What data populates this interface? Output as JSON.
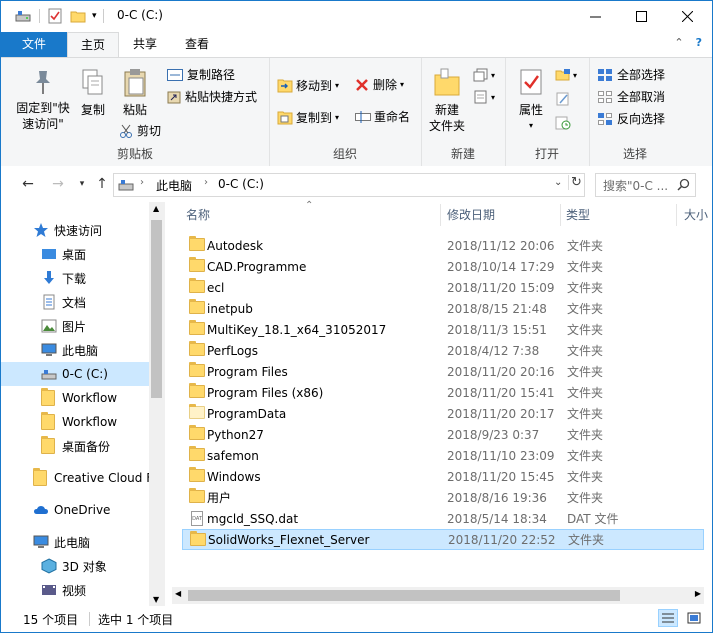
{
  "window": {
    "title": "0-C (C:)"
  },
  "tabs": [
    {
      "label": "文件"
    },
    {
      "label": "主页"
    },
    {
      "label": "共享"
    },
    {
      "label": "查看"
    }
  ],
  "ribbon": {
    "clipboard": {
      "pin_label": "固定到\"快\n速访问\"",
      "pin_label_line1": "固定到\"快",
      "pin_label_line2": "速访问\"",
      "copy_label": "复制",
      "paste_label": "粘贴",
      "copy_path_label": "复制路径",
      "paste_shortcut_label": "粘贴快捷方式",
      "cut_label": "剪切",
      "group_label": "剪贴板"
    },
    "organize": {
      "move_to_label": "移动到",
      "copy_to_label": "复制到",
      "delete_label": "删除",
      "rename_label": "重命名",
      "group_label": "组织"
    },
    "new": {
      "new_folder_line1": "新建",
      "new_folder_line2": "文件夹",
      "group_label": "新建"
    },
    "open": {
      "properties_label": "属性",
      "group_label": "打开"
    },
    "select": {
      "select_all_label": "全部选择",
      "select_none_label": "全部取消",
      "invert_label": "反向选择",
      "group_label": "选择"
    }
  },
  "address": {
    "segments": [
      "此电脑",
      "0-C (C:)"
    ],
    "search_placeholder": "搜索\"0-C ..."
  },
  "nav": {
    "items": [
      {
        "label": "快速访问",
        "icon": "star-icon",
        "pinned": false
      },
      {
        "label": "桌面",
        "icon": "desktop-icon",
        "pinned": true
      },
      {
        "label": "下载",
        "icon": "download-icon",
        "pinned": true
      },
      {
        "label": "文档",
        "icon": "document-icon",
        "pinned": true
      },
      {
        "label": "图片",
        "icon": "picture-icon",
        "pinned": true
      },
      {
        "label": "此电脑",
        "icon": "computer-icon",
        "pinned": true
      },
      {
        "label": "0-C (C:)",
        "icon": "drive-icon",
        "pinned": false
      },
      {
        "label": "Workflow",
        "icon": "folder-icon",
        "pinned": false
      },
      {
        "label": "Workflow",
        "icon": "folder-icon",
        "pinned": false
      },
      {
        "label": "桌面备份",
        "icon": "folder-icon",
        "pinned": false
      },
      {
        "label": "Creative Cloud F",
        "icon": "folder-icon",
        "pinned": false
      },
      {
        "label": "OneDrive",
        "icon": "cloud-icon",
        "pinned": false
      },
      {
        "label": "此电脑",
        "icon": "computer-icon",
        "pinned": false
      },
      {
        "label": "3D 对象",
        "icon": "cube-icon",
        "pinned": false
      },
      {
        "label": "视频",
        "icon": "video-icon",
        "pinned": false
      }
    ]
  },
  "columns": {
    "name": "名称",
    "date": "修改日期",
    "type": "类型",
    "size": "大小"
  },
  "files": [
    {
      "name": "Autodesk",
      "date": "2018/11/12 20:06",
      "type": "文件夹",
      "kind": "folder"
    },
    {
      "name": "CAD.Programme",
      "date": "2018/10/14 17:29",
      "type": "文件夹",
      "kind": "folder"
    },
    {
      "name": "ecl",
      "date": "2018/11/20 15:09",
      "type": "文件夹",
      "kind": "folder"
    },
    {
      "name": "inetpub",
      "date": "2018/8/15 21:48",
      "type": "文件夹",
      "kind": "folder"
    },
    {
      "name": "MultiKey_18.1_x64_31052017",
      "date": "2018/11/3 15:51",
      "type": "文件夹",
      "kind": "folder"
    },
    {
      "name": "PerfLogs",
      "date": "2018/4/12 7:38",
      "type": "文件夹",
      "kind": "folder"
    },
    {
      "name": "Program Files",
      "date": "2018/11/20 20:16",
      "type": "文件夹",
      "kind": "folder"
    },
    {
      "name": "Program Files (x86)",
      "date": "2018/11/20 15:41",
      "type": "文件夹",
      "kind": "folder"
    },
    {
      "name": "ProgramData",
      "date": "2018/11/20 20:17",
      "type": "文件夹",
      "kind": "folder-hidden"
    },
    {
      "name": "Python27",
      "date": "2018/9/23 0:37",
      "type": "文件夹",
      "kind": "folder"
    },
    {
      "name": "safemon",
      "date": "2018/11/10 23:09",
      "type": "文件夹",
      "kind": "folder"
    },
    {
      "name": "Windows",
      "date": "2018/11/20 15:45",
      "type": "文件夹",
      "kind": "folder"
    },
    {
      "name": "用户",
      "date": "2018/8/16 19:36",
      "type": "文件夹",
      "kind": "folder"
    },
    {
      "name": "mgcld_SSQ.dat",
      "date": "2018/5/14 18:34",
      "type": "DAT 文件",
      "kind": "file"
    },
    {
      "name": "SolidWorks_Flexnet_Server",
      "date": "2018/11/20 22:52",
      "type": "文件夹",
      "kind": "folder",
      "selected": true
    }
  ],
  "status": {
    "item_count": "15 个项目",
    "selected": "选中 1 个项目"
  }
}
